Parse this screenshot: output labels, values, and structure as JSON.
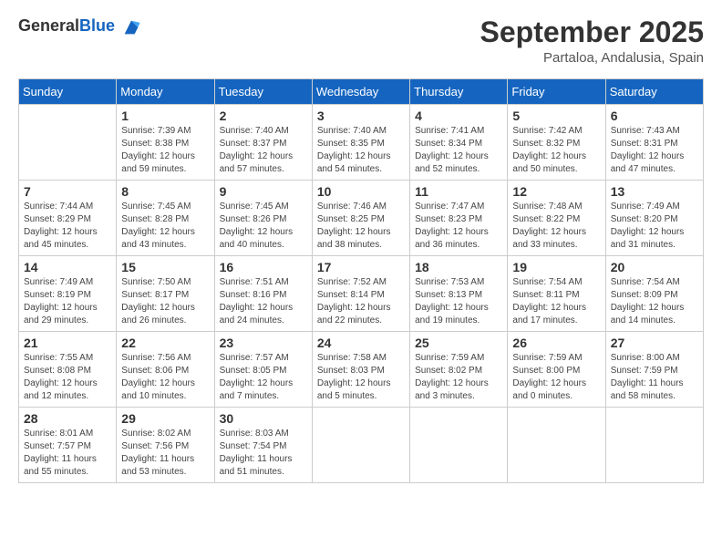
{
  "logo": {
    "general": "General",
    "blue": "Blue"
  },
  "title": {
    "month": "September 2025",
    "location": "Partaloa, Andalusia, Spain"
  },
  "weekdays": [
    "Sunday",
    "Monday",
    "Tuesday",
    "Wednesday",
    "Thursday",
    "Friday",
    "Saturday"
  ],
  "weeks": [
    [
      {
        "day": "",
        "info": ""
      },
      {
        "day": "1",
        "info": "Sunrise: 7:39 AM\nSunset: 8:38 PM\nDaylight: 12 hours\nand 59 minutes."
      },
      {
        "day": "2",
        "info": "Sunrise: 7:40 AM\nSunset: 8:37 PM\nDaylight: 12 hours\nand 57 minutes."
      },
      {
        "day": "3",
        "info": "Sunrise: 7:40 AM\nSunset: 8:35 PM\nDaylight: 12 hours\nand 54 minutes."
      },
      {
        "day": "4",
        "info": "Sunrise: 7:41 AM\nSunset: 8:34 PM\nDaylight: 12 hours\nand 52 minutes."
      },
      {
        "day": "5",
        "info": "Sunrise: 7:42 AM\nSunset: 8:32 PM\nDaylight: 12 hours\nand 50 minutes."
      },
      {
        "day": "6",
        "info": "Sunrise: 7:43 AM\nSunset: 8:31 PM\nDaylight: 12 hours\nand 47 minutes."
      }
    ],
    [
      {
        "day": "7",
        "info": "Sunrise: 7:44 AM\nSunset: 8:29 PM\nDaylight: 12 hours\nand 45 minutes."
      },
      {
        "day": "8",
        "info": "Sunrise: 7:45 AM\nSunset: 8:28 PM\nDaylight: 12 hours\nand 43 minutes."
      },
      {
        "day": "9",
        "info": "Sunrise: 7:45 AM\nSunset: 8:26 PM\nDaylight: 12 hours\nand 40 minutes."
      },
      {
        "day": "10",
        "info": "Sunrise: 7:46 AM\nSunset: 8:25 PM\nDaylight: 12 hours\nand 38 minutes."
      },
      {
        "day": "11",
        "info": "Sunrise: 7:47 AM\nSunset: 8:23 PM\nDaylight: 12 hours\nand 36 minutes."
      },
      {
        "day": "12",
        "info": "Sunrise: 7:48 AM\nSunset: 8:22 PM\nDaylight: 12 hours\nand 33 minutes."
      },
      {
        "day": "13",
        "info": "Sunrise: 7:49 AM\nSunset: 8:20 PM\nDaylight: 12 hours\nand 31 minutes."
      }
    ],
    [
      {
        "day": "14",
        "info": "Sunrise: 7:49 AM\nSunset: 8:19 PM\nDaylight: 12 hours\nand 29 minutes."
      },
      {
        "day": "15",
        "info": "Sunrise: 7:50 AM\nSunset: 8:17 PM\nDaylight: 12 hours\nand 26 minutes."
      },
      {
        "day": "16",
        "info": "Sunrise: 7:51 AM\nSunset: 8:16 PM\nDaylight: 12 hours\nand 24 minutes."
      },
      {
        "day": "17",
        "info": "Sunrise: 7:52 AM\nSunset: 8:14 PM\nDaylight: 12 hours\nand 22 minutes."
      },
      {
        "day": "18",
        "info": "Sunrise: 7:53 AM\nSunset: 8:13 PM\nDaylight: 12 hours\nand 19 minutes."
      },
      {
        "day": "19",
        "info": "Sunrise: 7:54 AM\nSunset: 8:11 PM\nDaylight: 12 hours\nand 17 minutes."
      },
      {
        "day": "20",
        "info": "Sunrise: 7:54 AM\nSunset: 8:09 PM\nDaylight: 12 hours\nand 14 minutes."
      }
    ],
    [
      {
        "day": "21",
        "info": "Sunrise: 7:55 AM\nSunset: 8:08 PM\nDaylight: 12 hours\nand 12 minutes."
      },
      {
        "day": "22",
        "info": "Sunrise: 7:56 AM\nSunset: 8:06 PM\nDaylight: 12 hours\nand 10 minutes."
      },
      {
        "day": "23",
        "info": "Sunrise: 7:57 AM\nSunset: 8:05 PM\nDaylight: 12 hours\nand 7 minutes."
      },
      {
        "day": "24",
        "info": "Sunrise: 7:58 AM\nSunset: 8:03 PM\nDaylight: 12 hours\nand 5 minutes."
      },
      {
        "day": "25",
        "info": "Sunrise: 7:59 AM\nSunset: 8:02 PM\nDaylight: 12 hours\nand 3 minutes."
      },
      {
        "day": "26",
        "info": "Sunrise: 7:59 AM\nSunset: 8:00 PM\nDaylight: 12 hours\nand 0 minutes."
      },
      {
        "day": "27",
        "info": "Sunrise: 8:00 AM\nSunset: 7:59 PM\nDaylight: 11 hours\nand 58 minutes."
      }
    ],
    [
      {
        "day": "28",
        "info": "Sunrise: 8:01 AM\nSunset: 7:57 PM\nDaylight: 11 hours\nand 55 minutes."
      },
      {
        "day": "29",
        "info": "Sunrise: 8:02 AM\nSunset: 7:56 PM\nDaylight: 11 hours\nand 53 minutes."
      },
      {
        "day": "30",
        "info": "Sunrise: 8:03 AM\nSunset: 7:54 PM\nDaylight: 11 hours\nand 51 minutes."
      },
      {
        "day": "",
        "info": ""
      },
      {
        "day": "",
        "info": ""
      },
      {
        "day": "",
        "info": ""
      },
      {
        "day": "",
        "info": ""
      }
    ]
  ]
}
